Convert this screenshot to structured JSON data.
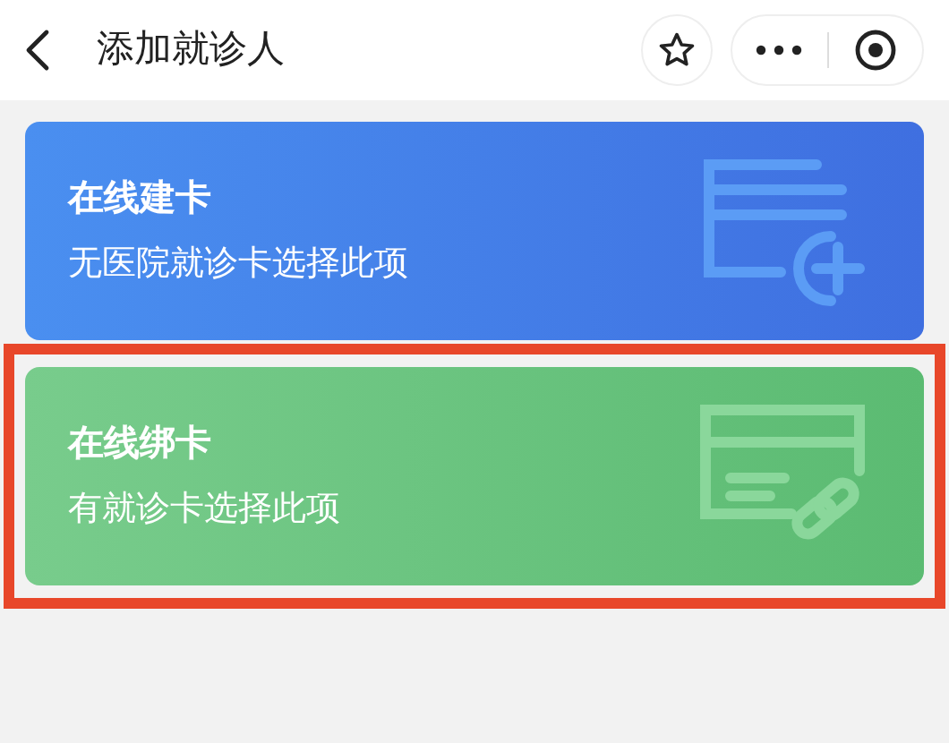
{
  "header": {
    "title": "添加就诊人"
  },
  "options": [
    {
      "kind": "create",
      "title": "在线建卡",
      "subtitle": "无医院就诊卡选择此项",
      "highlighted": false
    },
    {
      "kind": "bind",
      "title": "在线绑卡",
      "subtitle": "有就诊卡选择此项",
      "highlighted": true
    }
  ]
}
